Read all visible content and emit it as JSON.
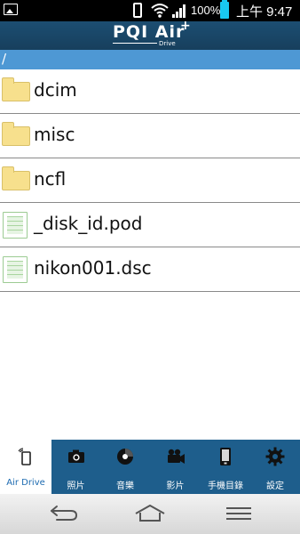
{
  "status_bar": {
    "battery_percent": "100%",
    "time": "上午 9:47"
  },
  "header": {
    "logo_text": "PQI Air",
    "logo_plus": "+",
    "logo_sub": "Drive"
  },
  "path": "/",
  "files": [
    {
      "name": "dcim",
      "icon": "folder-icon"
    },
    {
      "name": "misc",
      "icon": "folder-icon"
    },
    {
      "name": "ncfl",
      "icon": "folder-icon"
    },
    {
      "name": "_disk_id.pod",
      "icon": "document-icon"
    },
    {
      "name": "nikon001.dsc",
      "icon": "document-icon"
    }
  ],
  "tabs": [
    {
      "label": "Air Drive",
      "icon": "air-drive-icon",
      "active": true
    },
    {
      "label": "照片",
      "icon": "camera-icon"
    },
    {
      "label": "音樂",
      "icon": "music-icon"
    },
    {
      "label": "影片",
      "icon": "video-camera-icon"
    },
    {
      "label": "手機目錄",
      "icon": "phone-directory-icon"
    },
    {
      "label": "設定",
      "icon": "gear-icon"
    }
  ],
  "colors": {
    "header": "#1c4e72",
    "path_bar": "#4e98d4",
    "tab_bar": "#1e5e8c",
    "active_tab_text": "#1c6ab0"
  }
}
